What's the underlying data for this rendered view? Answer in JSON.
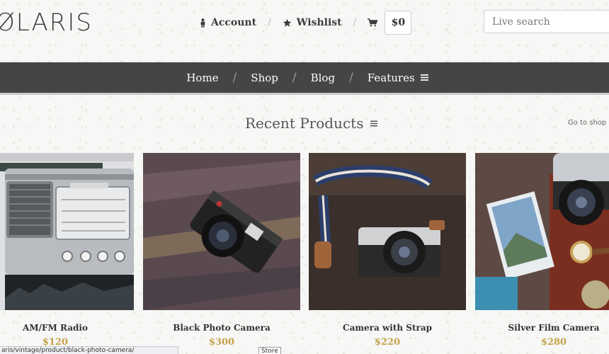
{
  "header": {
    "logo": "ØLARIS",
    "account_label": "Account",
    "account_icon": "person-icon",
    "wishlist_label": "Wishlist",
    "wishlist_icon": "star-icon",
    "cart_icon": "cart-icon",
    "cart_total": "$0",
    "search_placeholder": "Live search"
  },
  "nav": {
    "items": [
      {
        "label": "Home"
      },
      {
        "label": "Shop"
      },
      {
        "label": "Blog"
      },
      {
        "label": "Features"
      }
    ],
    "separator": "/",
    "menu_icon": "menu-icon"
  },
  "section": {
    "title": "Recent Products",
    "shop_link": "Go to shop h"
  },
  "products": [
    {
      "name": "AM/FM Radio",
      "price": "$120",
      "image": "radio"
    },
    {
      "name": "Black Photo Camera",
      "price": "$300",
      "image": "black-camera"
    },
    {
      "name": "Camera with Strap",
      "price": "$220",
      "image": "camera-strap"
    },
    {
      "name": "Silver Film Camera",
      "price": "$280",
      "image": "silver-camera"
    }
  ],
  "status": {
    "url": "aris/vintage/product/black-photo-camera/",
    "tooltip": "Store"
  },
  "colors": {
    "nav_bg": "#454545",
    "price": "#c3a148",
    "text": "#333333"
  }
}
